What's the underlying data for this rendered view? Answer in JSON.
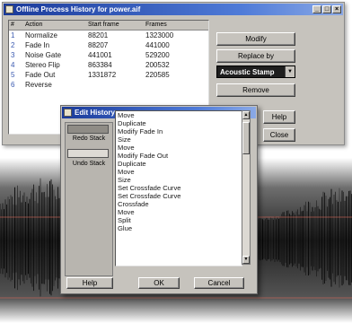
{
  "main_window": {
    "title": "Offline Process History for power.aif",
    "columns": [
      "#",
      "Action",
      "Start frame",
      "Frames"
    ],
    "rows": [
      {
        "num": "1",
        "action": "Normalize",
        "start": "88201",
        "frames": "1323000"
      },
      {
        "num": "2",
        "action": "Fade In",
        "start": "88207",
        "frames": "441000"
      },
      {
        "num": "3",
        "action": "Noise Gate",
        "start": "441001",
        "frames": "529200"
      },
      {
        "num": "4",
        "action": "Stereo Flip",
        "start": "863384",
        "frames": "200532"
      },
      {
        "num": "5",
        "action": "Fade Out",
        "start": "1331872",
        "frames": "220585"
      },
      {
        "num": "6",
        "action": "Reverse",
        "start": "",
        "frames": ""
      }
    ],
    "modify_label": "Modify",
    "replace_label": "Replace by",
    "replace_selected": "Acoustic Stamp",
    "remove_label": "Remove",
    "help_label": "Help",
    "close_label": "Close"
  },
  "edit_dialog": {
    "title": "Edit History",
    "redo_label": "Redo Stack",
    "undo_label": "Undo Stack",
    "items": [
      "Move",
      "Duplicate",
      "Modify Fade In",
      "Size",
      "Move",
      "Modify Fade Out",
      "Duplicate",
      "Move",
      "Size",
      "Set Crossfade Curve",
      "Set Crossfade Curve",
      "Crossfade",
      "Move",
      "Split",
      "Glue"
    ],
    "help_label": "Help",
    "ok_label": "OK",
    "cancel_label": "Cancel"
  },
  "icons": [
    "window-icon",
    "minimize-icon",
    "maximize-icon",
    "close-icon",
    "dropdown-arrow-icon",
    "scroll-up-icon",
    "scroll-down-icon"
  ],
  "colors": {
    "titlebar": "#1a3a9a",
    "window_bg": "#c6c3bd",
    "selected_dropdown": "#1e1e1e"
  }
}
